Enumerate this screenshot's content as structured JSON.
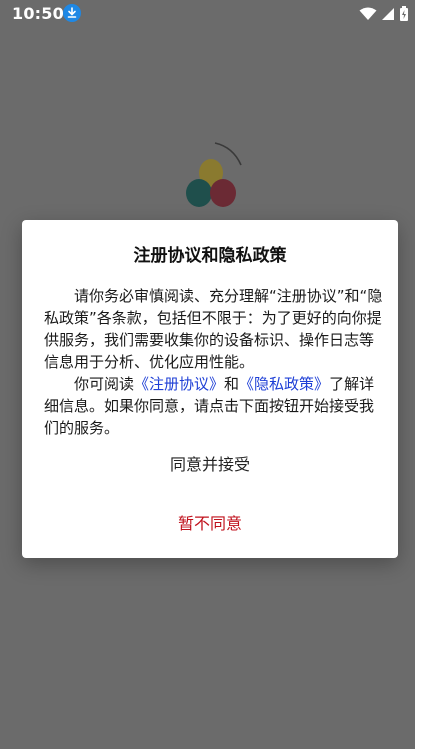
{
  "statusbar": {
    "time": "10:50"
  },
  "dialog": {
    "title": "注册协议和隐私政策",
    "paragraph1": "请你务必审慎阅读、充分理解“注册协议”和“隐私政策”各条款，包括但不限于：为了更好的向你提供服务，我们需要收集你的设备标识、操作日志等信息用于分析、优化应用性能。",
    "p2_prefix": "你可阅读",
    "p2_link1": "《注册协议》",
    "p2_and": "和",
    "p2_link2": "《隐私政策》",
    "p2_suffix": "了解详细信息。如果你同意，请点击下面按钮开始接受我们的服务。",
    "accept_label": "同意并接受",
    "decline_label": "暂不同意"
  },
  "colors": {
    "overlay_bg": "#6b6b6b",
    "link": "#1e3fd6",
    "decline": "#c0111c",
    "download_badge": "#1e88e5"
  },
  "icons": {
    "download": "download-icon",
    "wifi": "wifi-icon",
    "signal": "signal-icon",
    "battery": "battery-icon",
    "logo": "app-logo-icon"
  }
}
